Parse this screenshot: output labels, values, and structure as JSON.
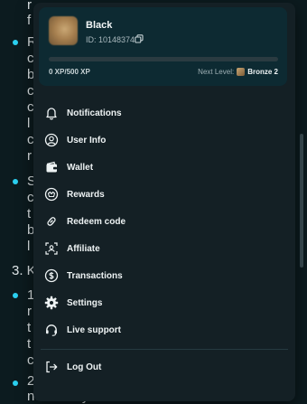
{
  "background": {
    "fragments": [
      "r",
      "f",
      "R",
      "c",
      "b",
      "c",
      "c",
      "l",
      "c",
      "r",
      "S",
      "c",
      "t",
      "b",
      "l",
      "3. K",
      "1",
      "r",
      "t",
      "t",
      "c",
      "2. ",
      "necessary documents are in our"
    ]
  },
  "profile": {
    "username": "Black",
    "user_id": "ID: 10148374",
    "xp_text": "0 XP/500 XP",
    "xp_progress": 0.0,
    "next_level_label": "Next Level:",
    "next_level_value": "Bronze 2"
  },
  "menu": {
    "items": [
      {
        "key": "notifications",
        "label": "Notifications",
        "icon": "bell-icon"
      },
      {
        "key": "user-info",
        "label": "User Info",
        "icon": "user-icon"
      },
      {
        "key": "wallet",
        "label": "Wallet",
        "icon": "wallet-icon"
      },
      {
        "key": "rewards",
        "label": "Rewards",
        "icon": "rewards-icon"
      },
      {
        "key": "redeem-code",
        "label": "Redeem code",
        "icon": "link-icon"
      },
      {
        "key": "affiliate",
        "label": "Affiliate",
        "icon": "affiliate-icon"
      },
      {
        "key": "transactions",
        "label": "Transactions",
        "icon": "dollar-icon"
      },
      {
        "key": "settings",
        "label": "Settings",
        "icon": "gear-icon"
      },
      {
        "key": "live-support",
        "label": "Live support",
        "icon": "headset-icon"
      }
    ],
    "logout": {
      "label": "Log Out",
      "icon": "logout-icon"
    }
  },
  "colors": {
    "page_bg": "#0c1b1f",
    "panel_bg": "#142025",
    "card_bg": "#0d2a32",
    "accent": "#2bd0f0",
    "xp_fill": "#38d6b8"
  }
}
